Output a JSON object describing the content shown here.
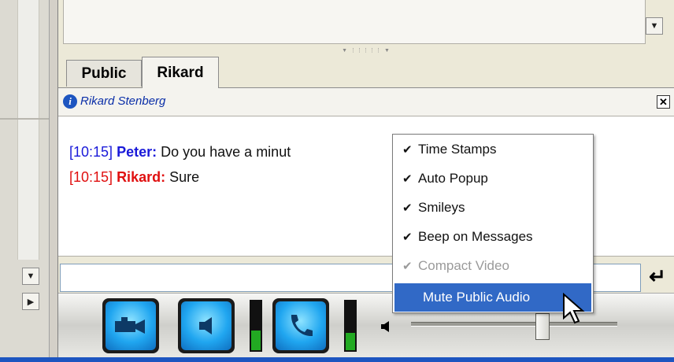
{
  "tabs": [
    {
      "label": "Public",
      "active": false
    },
    {
      "label": "Rikard",
      "active": true
    }
  ],
  "info_bar": {
    "name": "Rikard Stenberg",
    "icon": "info-icon"
  },
  "chat": {
    "messages": [
      {
        "time": "[10:15]",
        "user": "Peter:",
        "text": "Do you have a minut",
        "color": "#1a1ad9"
      },
      {
        "time": "[10:15]",
        "user": "Rikard:",
        "text": "Sure",
        "color": "#e01010"
      }
    ]
  },
  "input": {
    "value": "",
    "placeholder": ""
  },
  "context_menu": {
    "items": [
      {
        "label": "Time Stamps",
        "checked": true,
        "disabled": false
      },
      {
        "label": "Auto Popup",
        "checked": true,
        "disabled": false
      },
      {
        "label": "Smileys",
        "checked": true,
        "disabled": false
      },
      {
        "label": "Beep on Messages",
        "checked": true,
        "disabled": false
      },
      {
        "label": "Compact Video",
        "checked": true,
        "disabled": true
      },
      {
        "label": "Mute Public Audio",
        "checked": false,
        "highlighted": true
      }
    ]
  },
  "toolbar": {
    "buttons": [
      {
        "name": "video-camera-icon"
      },
      {
        "name": "speaker-icon"
      },
      {
        "name": "phone-icon"
      }
    ],
    "level_meters": [
      0.4,
      0.35
    ],
    "volume": 0.6
  },
  "colors": {
    "accent": "#3169c6",
    "statusbar": "#1d55c0"
  }
}
